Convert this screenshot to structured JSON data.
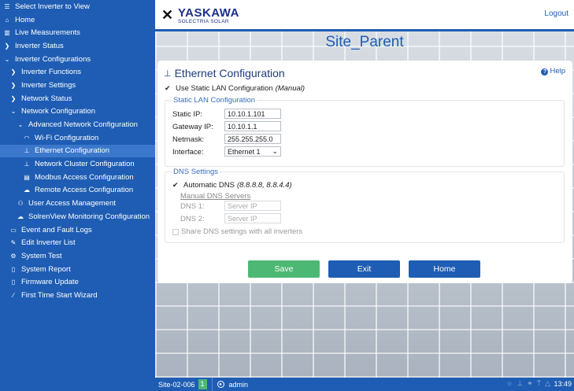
{
  "sidebar": {
    "items": [
      {
        "label": "Select Inverter to View",
        "icon": "list-icon"
      },
      {
        "label": "Home",
        "icon": "home-icon"
      },
      {
        "label": "Live Measurements",
        "icon": "chart-icon"
      },
      {
        "label": "Inverter Status",
        "icon": "chevron-right-icon"
      },
      {
        "label": "Inverter Configurations",
        "icon": "chevron-down-icon"
      },
      {
        "label": "Inverter Functions",
        "icon": "chevron-right-icon"
      },
      {
        "label": "Inverter Settings",
        "icon": "chevron-right-icon"
      },
      {
        "label": "Network Status",
        "icon": "chevron-right-icon"
      },
      {
        "label": "Network Configuration",
        "icon": "chevron-down-icon"
      },
      {
        "label": "Advanced Network Configuration",
        "icon": "chevron-down-icon"
      },
      {
        "label": "Wi-Fi Configuration",
        "icon": "wifi-icon"
      },
      {
        "label": "Ethernet Configuration",
        "icon": "sitemap-icon"
      },
      {
        "label": "Network Cluster Configuration",
        "icon": "sitemap-icon"
      },
      {
        "label": "Modbus Access Configuration",
        "icon": "server-icon"
      },
      {
        "label": "Remote Access Configuration",
        "icon": "cloud-icon"
      },
      {
        "label": "User Access Management",
        "icon": "users-icon"
      },
      {
        "label": "SolrenView Monitoring Configuration",
        "icon": "cloud-icon"
      },
      {
        "label": "Event and Fault Logs",
        "icon": "document-icon"
      },
      {
        "label": "Edit Inverter List",
        "icon": "edit-icon"
      },
      {
        "label": "System Test",
        "icon": "gears-icon"
      },
      {
        "label": "System Report",
        "icon": "file-icon"
      },
      {
        "label": "Firmware Update",
        "icon": "file-icon"
      },
      {
        "label": "First Time Start Wizard",
        "icon": "wand-icon"
      }
    ]
  },
  "header": {
    "logo_main": "YASKAWA",
    "logo_sub": "SOLECTRIA SOLAR",
    "logout": "Logout"
  },
  "site_title": "Site_Parent",
  "panel": {
    "title": "Ethernet Configuration",
    "help": "Help",
    "use_static": {
      "label": "Use Static LAN Configuration",
      "mode": "(Manual)",
      "checked": true
    },
    "static_lan": {
      "legend": "Static LAN Configuration",
      "static_ip_label": "Static IP:",
      "static_ip": "10.10.1.101",
      "gateway_label": "Gateway IP:",
      "gateway": "10.10.1.1",
      "netmask_label": "Netmask:",
      "netmask": "255.255.255.0",
      "interface_label": "Interface:",
      "interface": "Ethernet 1"
    },
    "dns": {
      "legend": "DNS Settings",
      "auto_label": "Automatic DNS",
      "auto_servers": "(8.8.8.8, 8.8.4.4)",
      "manual_heading": "Manual DNS Servers",
      "dns1_label": "DNS 1:",
      "dns2_label": "DNS 2:",
      "placeholder": "Server IP",
      "share_label": "Share DNS settings with all inverters"
    },
    "buttons": {
      "save": "Save",
      "exit": "Exit",
      "home": "Home"
    }
  },
  "footer": {
    "site_id": "Site-02-006",
    "badge": "1",
    "user": "admin",
    "time": "13:49"
  },
  "colors": {
    "brand": "#1e5db3",
    "save": "#4db873"
  }
}
